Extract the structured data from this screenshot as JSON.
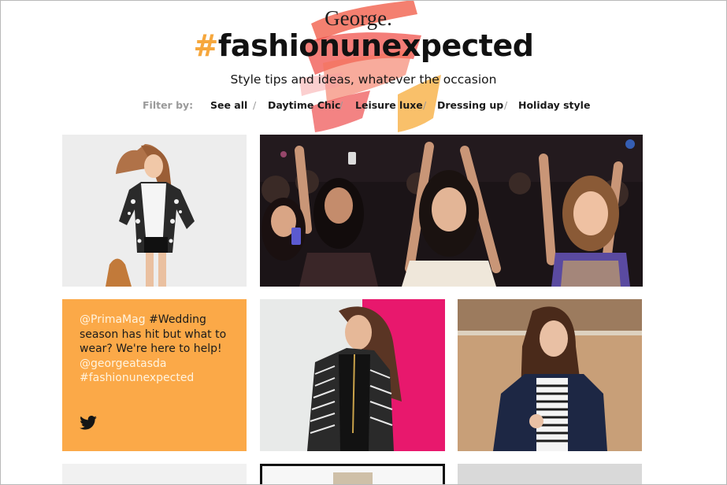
{
  "brand": {
    "logo": "George."
  },
  "hero": {
    "hash_symbol": "#",
    "hashtag": "fashionunexpected",
    "tagline": "Style tips and ideas, whatever the occasion"
  },
  "filters": {
    "label": "Filter by:",
    "separator": "/",
    "items": [
      "See all",
      "Daytime Chic",
      "Leisure luxe",
      "Dressing up",
      "Holiday style"
    ]
  },
  "tweet": {
    "handle": "@PrimaMag",
    "hashtag1": "#Wedding",
    "text": "season has hit but what to wear? We're here to help!",
    "mention": "@georgeatasda",
    "hashtag2": "#fashionunexpected",
    "icon": "twitter-bird-icon"
  },
  "tiles": {
    "tile1": "woman-leopard-jacket-photo",
    "tile2": "concert-crowd-photo",
    "tile3": "woman-tribal-jacket-photo",
    "tile4": "woman-navy-blazer-photo"
  },
  "colors": {
    "accent_orange": "#fba948",
    "hash_orange": "#f6a73d",
    "brush_red": "#f0524b",
    "filter_gray": "#9a9a9a"
  }
}
